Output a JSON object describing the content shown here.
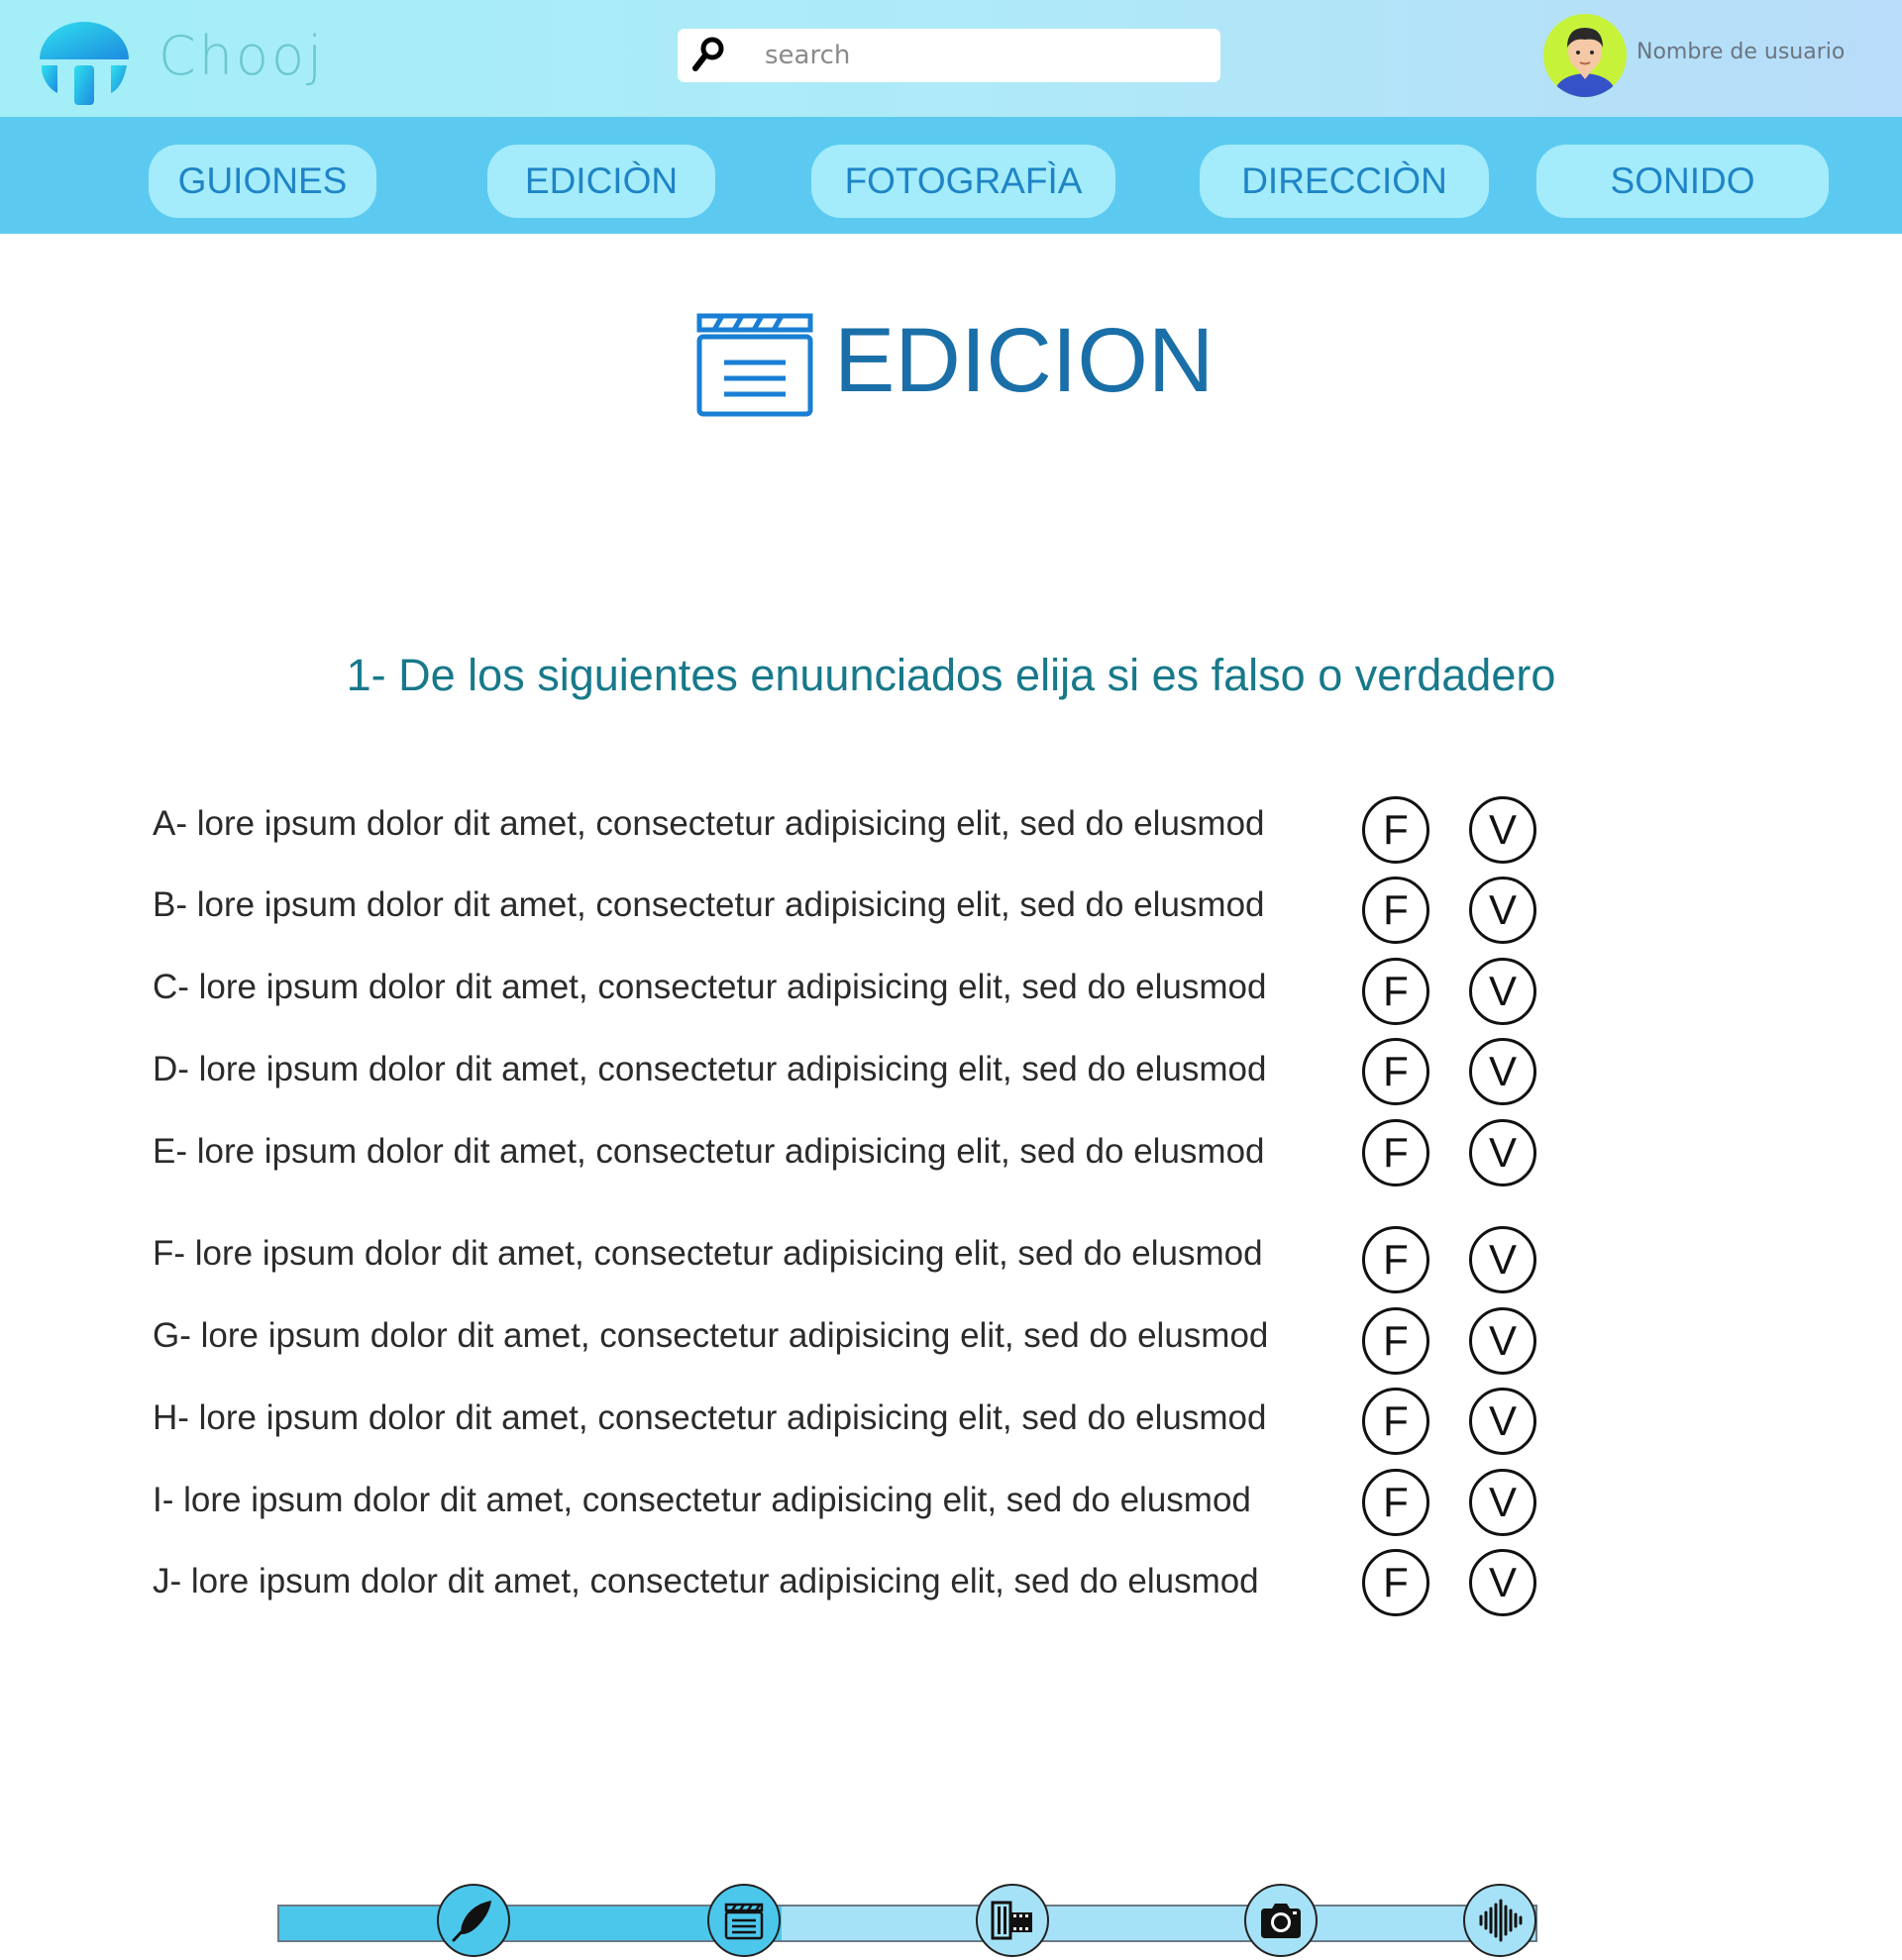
{
  "app": {
    "name": "Chooj",
    "username": "Nombre de usuario",
    "search_placeholder": "search"
  },
  "nav": {
    "tabs": [
      "GUIONES",
      "EDICIÒN",
      "FOTOGRAFÌA",
      "DIRECCIÒN",
      "SONIDO"
    ]
  },
  "page": {
    "title": "EDICION",
    "title_icon": "clapperboard-icon"
  },
  "quiz": {
    "question": "1- De los siguientes enuunciados elija si es falso o verdadero",
    "false_label": "F",
    "true_label": "V",
    "items": [
      "A- lore ipsum dolor dit amet, consectetur adipisicing elit, sed do elusmod",
      "B- lore ipsum dolor dit amet, consectetur adipisicing elit, sed do elusmod",
      "C- lore ipsum dolor dit amet, consectetur adipisicing elit, sed do elusmod",
      "D- lore ipsum dolor dit amet, consectetur adipisicing elit, sed do elusmod",
      "E- lore ipsum dolor dit amet, consectetur adipisicing elit, sed do elusmod",
      "F- lore ipsum dolor dit amet, consectetur adipisicing elit, sed do elusmod",
      "G- lore ipsum dolor dit amet, consectetur adipisicing elit, sed do elusmod",
      "H- lore ipsum dolor dit amet, consectetur adipisicing elit, sed do elusmod",
      "I- lore ipsum dolor dit amet, consectetur adipisicing elit, sed do elusmod",
      "J- lore ipsum dolor dit amet, consectetur adipisicing elit, sed do elusmod"
    ]
  },
  "progress": {
    "completed_fraction": 0.4,
    "steps": [
      {
        "icon": "feather-icon",
        "done": true
      },
      {
        "icon": "clapperboard-icon",
        "done": true
      },
      {
        "icon": "film-strip-icon",
        "done": false
      },
      {
        "icon": "camera-icon",
        "done": false
      },
      {
        "icon": "sound-wave-icon",
        "done": false
      }
    ]
  },
  "colors": {
    "header_bg": "#a3eef7",
    "nav_bg": "#5ccaf0",
    "tab_bg": "#a4ecfb",
    "tab_text": "#1f84c6",
    "title": "#1a6fa8",
    "question": "#17798a",
    "progress_done": "#4cc7ec",
    "progress_todo": "#a6e2f7"
  }
}
